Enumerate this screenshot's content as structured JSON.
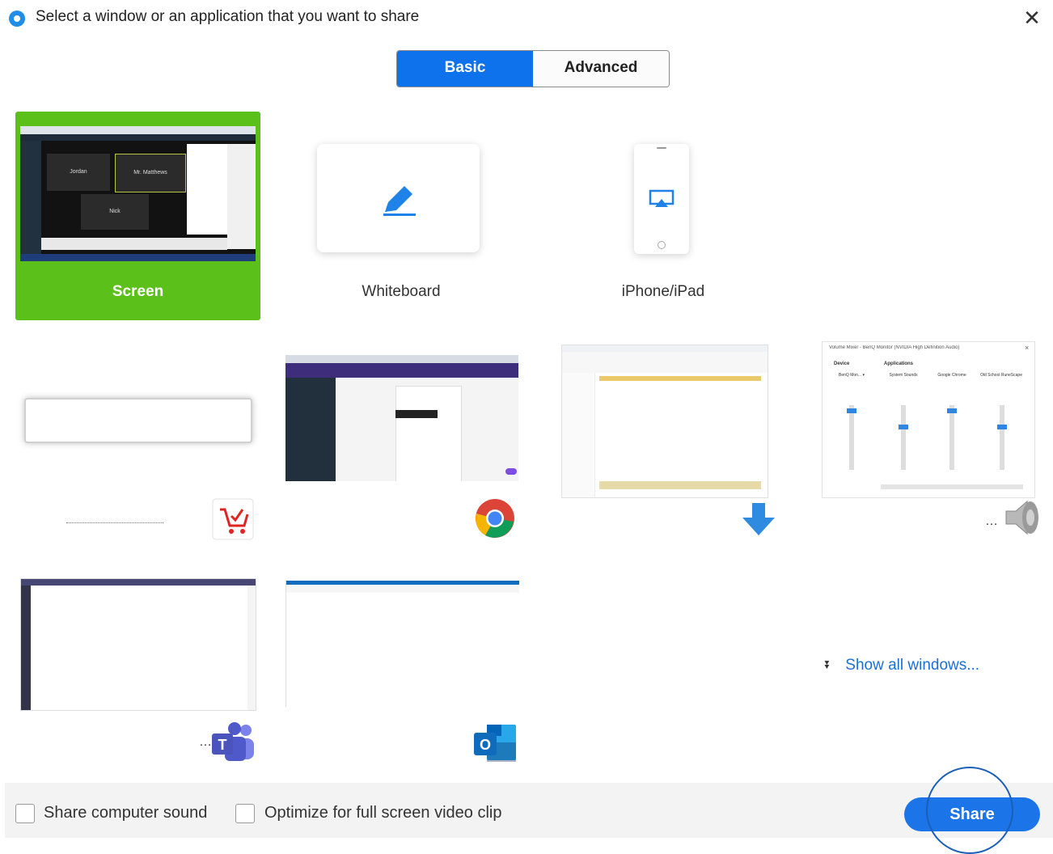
{
  "header": {
    "title": "Select a window or an application that you want to share",
    "close_glyph": "✕"
  },
  "tabs": {
    "basic": "Basic",
    "advanced": "Advanced",
    "selected": "Basic"
  },
  "tiles": {
    "screen": {
      "label": "Screen",
      "thumb_tiles": [
        "Jordan",
        "Mr. Matthews",
        "Nick"
      ]
    },
    "whiteboard": {
      "label": "Whiteboard",
      "icon": "pencil-icon"
    },
    "iphone": {
      "label": "iPhone/iPad",
      "icon": "airplay-icon"
    }
  },
  "windows": [
    {
      "name": "main-window",
      "app_icon": "cart-checkmark-icon"
    },
    {
      "name": "chrome-window",
      "app_icon": "chrome-icon"
    },
    {
      "name": "explorer-window",
      "app_icon": "download-arrow-icon"
    },
    {
      "name": "volume-mixer-window",
      "app_icon": "speaker-icon",
      "title": "Volume Mixer - BenQ Monitor (NVIDIA High Definition Audio)",
      "device_header": "Device",
      "apps_header": "Applications",
      "channels": [
        "BenQ Mon... ▾",
        "System Sounds",
        "Google Chrome",
        "Old School RuneScape"
      ]
    },
    {
      "name": "teams-window",
      "app_icon": "teams-icon"
    },
    {
      "name": "outlook-window",
      "app_icon": "outlook-icon"
    }
  ],
  "show_all": "Show all windows...",
  "footer": {
    "share_sound": "Share computer sound",
    "optimize_video": "Optimize for full screen video clip",
    "share_button": "Share"
  },
  "colors": {
    "accent": "#0e72ed",
    "screen_selected": "#5cc01a",
    "share_button": "#1b74e8"
  }
}
